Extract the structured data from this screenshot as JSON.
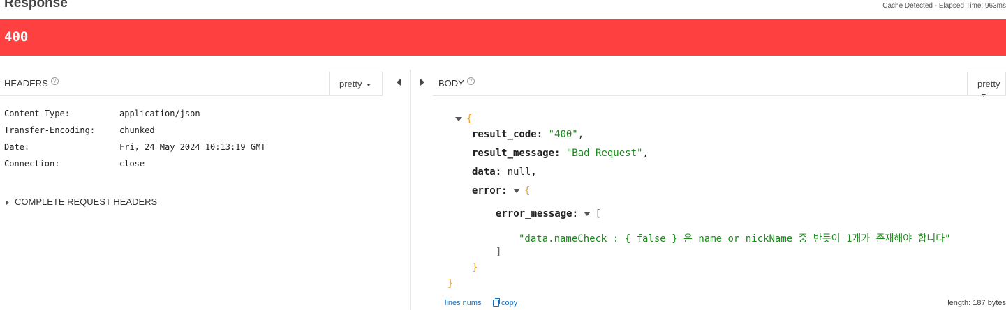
{
  "response": {
    "title": "Response",
    "cache_info": "Cache Detected - Elapsed Time: 963ms",
    "status_code": "400"
  },
  "headers_panel": {
    "label": "HEADERS",
    "help": "?",
    "pretty_label": "pretty",
    "rows": [
      {
        "key": "Content-Type:",
        "value": "application/json"
      },
      {
        "key": "Transfer-Encoding:",
        "value": "chunked"
      },
      {
        "key": "Date:",
        "value": "Fri, 24 May 2024 10:13:19 GMT"
      },
      {
        "key": "Connection:",
        "value": "close"
      }
    ],
    "complete_headers_label": "COMPLETE REQUEST HEADERS"
  },
  "body_panel": {
    "label": "BODY",
    "help": "?",
    "pretty_label": "pretty",
    "json": {
      "open_brace": "{",
      "close_brace": "}",
      "result_code_key": "result_code:",
      "result_code_value": "\"400\"",
      "result_message_key": "result_message:",
      "result_message_value": "\"Bad Request\"",
      "data_key": "data:",
      "data_value": "null",
      "error_key": "error:",
      "error_open": "{",
      "error_close": "}",
      "error_message_key": "error_message:",
      "array_open": "[",
      "array_close": "]",
      "error_message_item": "\"data.nameCheck : { false } 은 name or nickName 중 반듯이 1개가 존재해야 합니다\""
    },
    "footer": {
      "lines_nums": "lines nums",
      "copy": "copy",
      "length": "length: 187 bytes"
    }
  },
  "colors": {
    "status_bar": "#ff4040",
    "string": "#1a8a1a",
    "brace": "#f0a030",
    "link": "#1a6ec0"
  }
}
